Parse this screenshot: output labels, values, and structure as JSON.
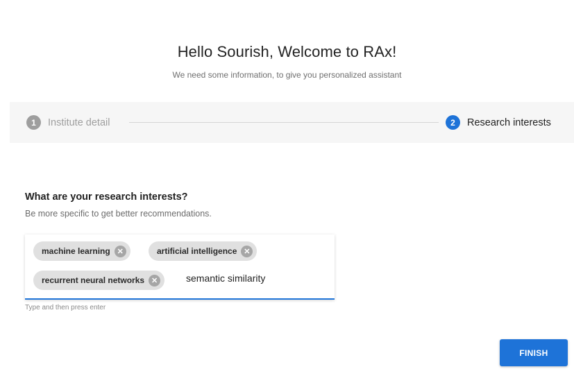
{
  "header": {
    "title": "Hello Sourish, Welcome to RAx!",
    "subtitle": "We need some information, to give you personalized assistant"
  },
  "stepper": {
    "steps": [
      {
        "number": "1",
        "label": "Institute detail",
        "state": "completed"
      },
      {
        "number": "2",
        "label": "Research interests",
        "state": "active"
      }
    ]
  },
  "form": {
    "question": "What are your research interests?",
    "hint": "Be more specific to get better recommendations.",
    "chips": [
      {
        "label": "machine learning"
      },
      {
        "label": "artificial intelligence"
      },
      {
        "label": "recurrent neural networks"
      }
    ],
    "remove_glyph": "✕",
    "input_value": "semantic similarity",
    "helper_text": "Type and then press enter"
  },
  "actions": {
    "finish_label": "FINISH"
  },
  "colors": {
    "accent": "#1e73d8",
    "inactive_step": "#9e9e9e",
    "chip_bg": "#e0e0e0"
  }
}
